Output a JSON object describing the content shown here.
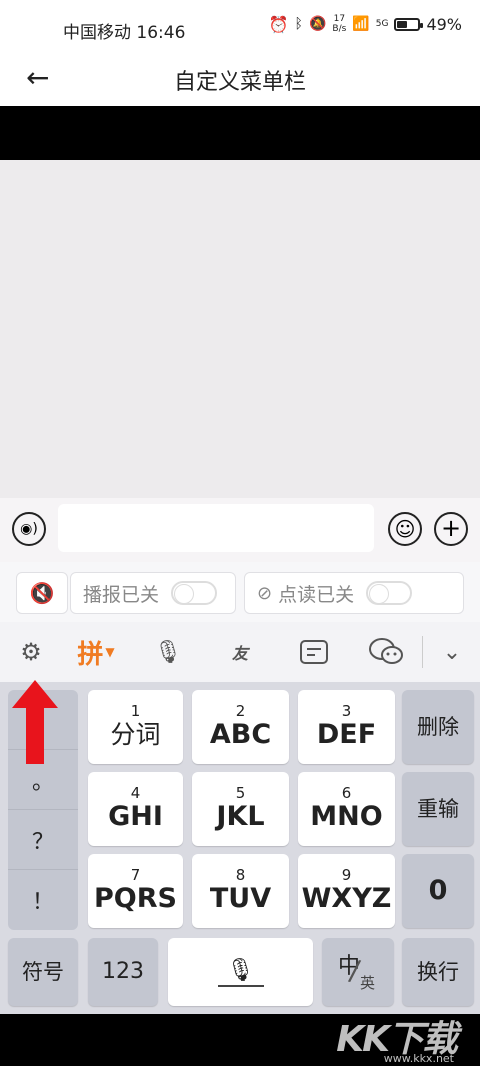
{
  "status_bar": {
    "carrier_time": "中国移动 16:46",
    "net_speed_value": "17",
    "net_speed_unit": "B/s",
    "signal_label": "5G",
    "battery": "49%",
    "battery_level": 0.49
  },
  "header": {
    "back_icon": "arrow-left-icon",
    "title": "自定义菜单栏"
  },
  "input_bar": {
    "voice_icon": "voice-icon",
    "text_value": "",
    "emoji_icon": "emoji-icon",
    "plus_icon": "plus-icon"
  },
  "keyboard": {
    "toggles": {
      "mute_icon": "speaker-mute-icon",
      "broadcast_label": "播报已关",
      "broadcast_on": false,
      "read_icon": "read-off-icon",
      "read_label": "点读已关",
      "read_on": false
    },
    "toolbar": {
      "settings_icon": "gear-icon",
      "ime_label": "拼",
      "mic_icon": "mic-icon",
      "youpin_label": "友",
      "note_icon": "note-icon",
      "wechat_icon": "wechat-icon",
      "collapse_icon": "chevron-down-icon"
    },
    "side_symbols": [
      "，",
      "。",
      "？",
      "！"
    ],
    "keys": [
      {
        "num": "1",
        "label": "分词"
      },
      {
        "num": "2",
        "label": "ABC"
      },
      {
        "num": "3",
        "label": "DEF"
      },
      {
        "num": "4",
        "label": "GHI"
      },
      {
        "num": "5",
        "label": "JKL"
      },
      {
        "num": "6",
        "label": "MNO"
      },
      {
        "num": "7",
        "label": "PQRS"
      },
      {
        "num": "8",
        "label": "TUV"
      },
      {
        "num": "9",
        "label": "WXYZ"
      }
    ],
    "delete_label": "删除",
    "retype_label": "重输",
    "zero_label": "0",
    "symbols_label": "符号",
    "numbers_label": "123",
    "cn_label": "中",
    "en_label": "英",
    "enter_label": "换行"
  },
  "watermark": {
    "text": "KK下载",
    "url": "www.kkx.net"
  },
  "colors": {
    "accent": "#f07b22",
    "arrow": "#e8141c",
    "key_dark": "#c3c6d0",
    "content_bg": "#edebed"
  }
}
